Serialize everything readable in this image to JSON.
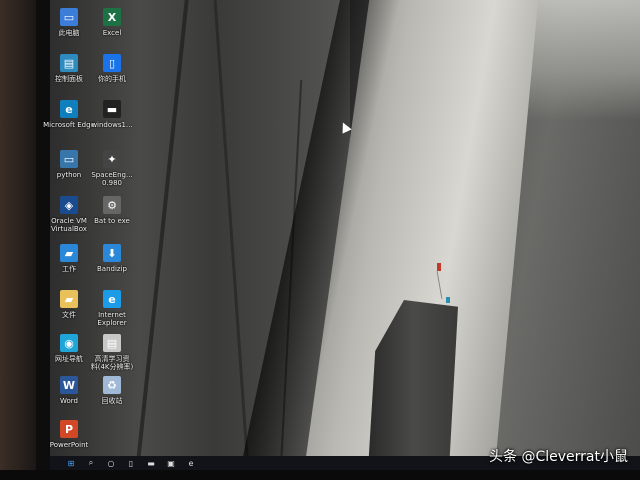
{
  "desktop": {
    "icons": [
      {
        "label": "此电脑",
        "icon": "computer-icon",
        "color": "#3b7dd8"
      },
      {
        "label": "Excel",
        "icon": "excel-icon",
        "color": "#1e7145"
      },
      {
        "label": "控制面板",
        "icon": "control-panel-icon",
        "color": "#2e8bc0"
      },
      {
        "label": "你的手机",
        "icon": "phone-icon",
        "color": "#1a73e8"
      },
      {
        "label": "Microsoft Edge",
        "icon": "edge-icon",
        "color": "#0f7fbd"
      },
      {
        "label": "windows1...",
        "icon": "shortcut-icon",
        "color": "#222222"
      },
      {
        "label": "python",
        "icon": "python-icon",
        "color": "#3776ab"
      },
      {
        "label": "SpaceEng...\n0.980",
        "icon": "spaceengine-icon",
        "color": "#444444"
      },
      {
        "label": "Oracle VM\nVirtualBox",
        "icon": "virtualbox-icon",
        "color": "#1a4b8f"
      },
      {
        "label": "Bat to exe",
        "icon": "gear-icon",
        "color": "#666666"
      },
      {
        "label": "工作",
        "icon": "folder-icon",
        "color": "#2b88d8"
      },
      {
        "label": "Bandizip",
        "icon": "bandizip-icon",
        "color": "#2b88d8"
      },
      {
        "label": "文件",
        "icon": "folder-icon",
        "color": "#e8c15a"
      },
      {
        "label": "Internet\nExplorer",
        "icon": "ie-icon",
        "color": "#1c9be6"
      },
      {
        "label": "网址导航",
        "icon": "browser-icon",
        "color": "#20a5d8"
      },
      {
        "label": "高清学习资\n料(4K分辨率)",
        "icon": "document-icon",
        "color": "#c8c8c8"
      },
      {
        "label": "Word",
        "icon": "word-icon",
        "color": "#2b579a"
      },
      {
        "label": "回收站",
        "icon": "recycle-bin-icon",
        "color": "#9fb9d6"
      },
      {
        "label": "PowerPoint",
        "icon": "powerpoint-icon",
        "color": "#d24726"
      }
    ]
  },
  "taskbar": {
    "items": [
      {
        "name": "start-button-icon",
        "glyph": "⊞"
      },
      {
        "name": "search-icon",
        "glyph": "⌕"
      },
      {
        "name": "cortana-icon",
        "glyph": "○"
      },
      {
        "name": "task-view-icon",
        "glyph": "▯"
      },
      {
        "name": "file-explorer-icon",
        "glyph": "▬"
      },
      {
        "name": "store-icon",
        "glyph": "▣"
      },
      {
        "name": "edge-taskbar-icon",
        "glyph": "e"
      }
    ]
  },
  "watermark": "头条 @Cleverrat小鼠"
}
